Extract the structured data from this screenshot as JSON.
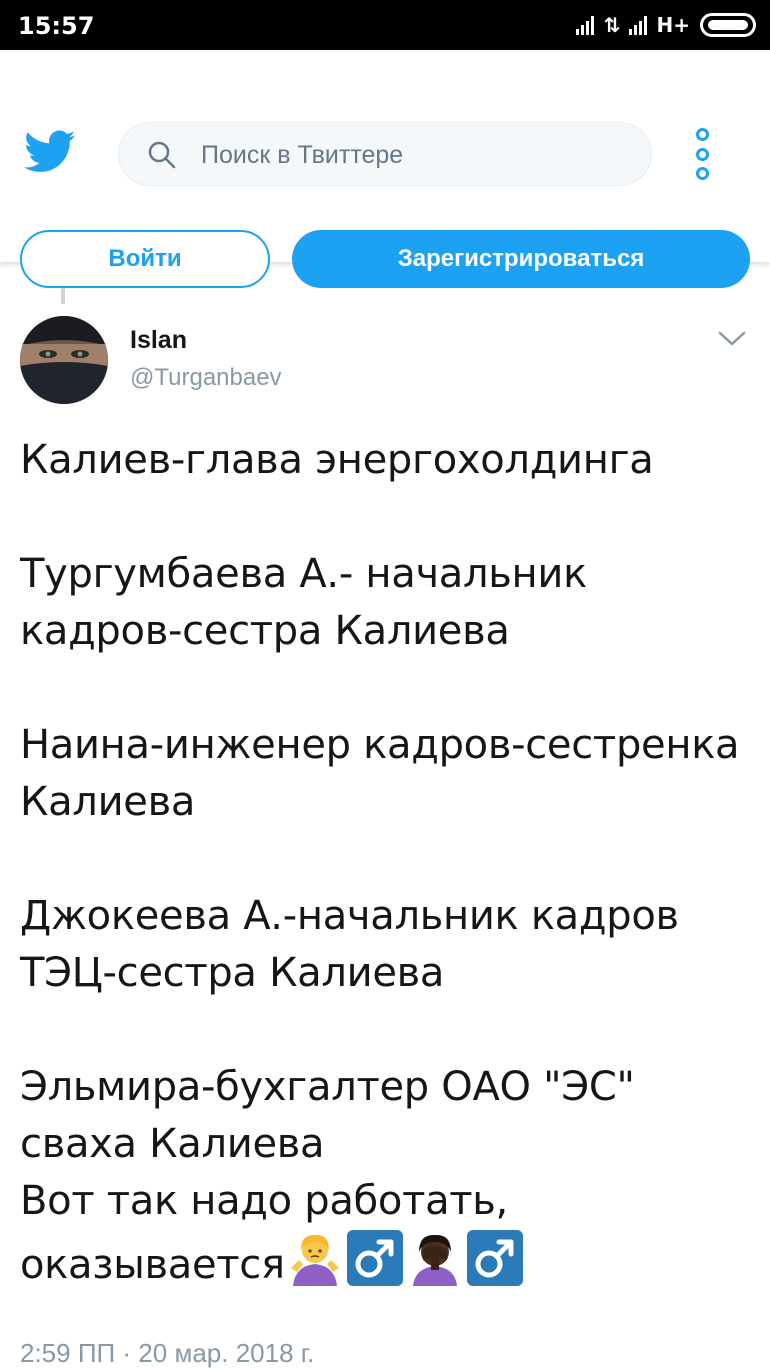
{
  "status_bar": {
    "time": "15:57",
    "signal_icon": "signal-icon",
    "data_arrows": "⇅",
    "network": "H+",
    "battery_icon": "battery-icon"
  },
  "header": {
    "logo_icon": "twitter-bird-icon",
    "search": {
      "placeholder": "Поиск в Твиттере",
      "icon": "search-icon"
    },
    "menu_icon": "more-options-icon",
    "login_label": "Войти",
    "signup_label": "Зарегистрироваться",
    "accent_color": "#1da1f2"
  },
  "tweet": {
    "author": {
      "name": "Islan",
      "handle": "@Turganbaev",
      "avatar_icon": "avatar"
    },
    "chevron_icon": "chevron-down-icon",
    "paragraphs": [
      {
        "lines": [
          "Калиев-глава энергохолдинга"
        ]
      },
      {
        "lines": [
          "Тургумбаева А.- начальник",
          "кадров-сестра Калиева"
        ]
      },
      {
        "lines": [
          "Наина-инженер кадров-сестренка",
          "Калиева"
        ]
      },
      {
        "lines": [
          "Джокеева А.-начальник кадров",
          "ТЭЦ-сестра Калиева"
        ]
      },
      {
        "lines": [
          "Эльмира-бухгалтер ОАО \"ЭС\"",
          "сваха Калиева",
          "Вот так надо работать,",
          "оказывается"
        ]
      }
    ],
    "emojis": [
      "person-shrugging-emoji",
      "male-sign-emoji",
      "person-facepalming-emoji",
      "male-sign-emoji"
    ],
    "timestamp": "2:59 ПП · 20 мар. 2018 г."
  }
}
